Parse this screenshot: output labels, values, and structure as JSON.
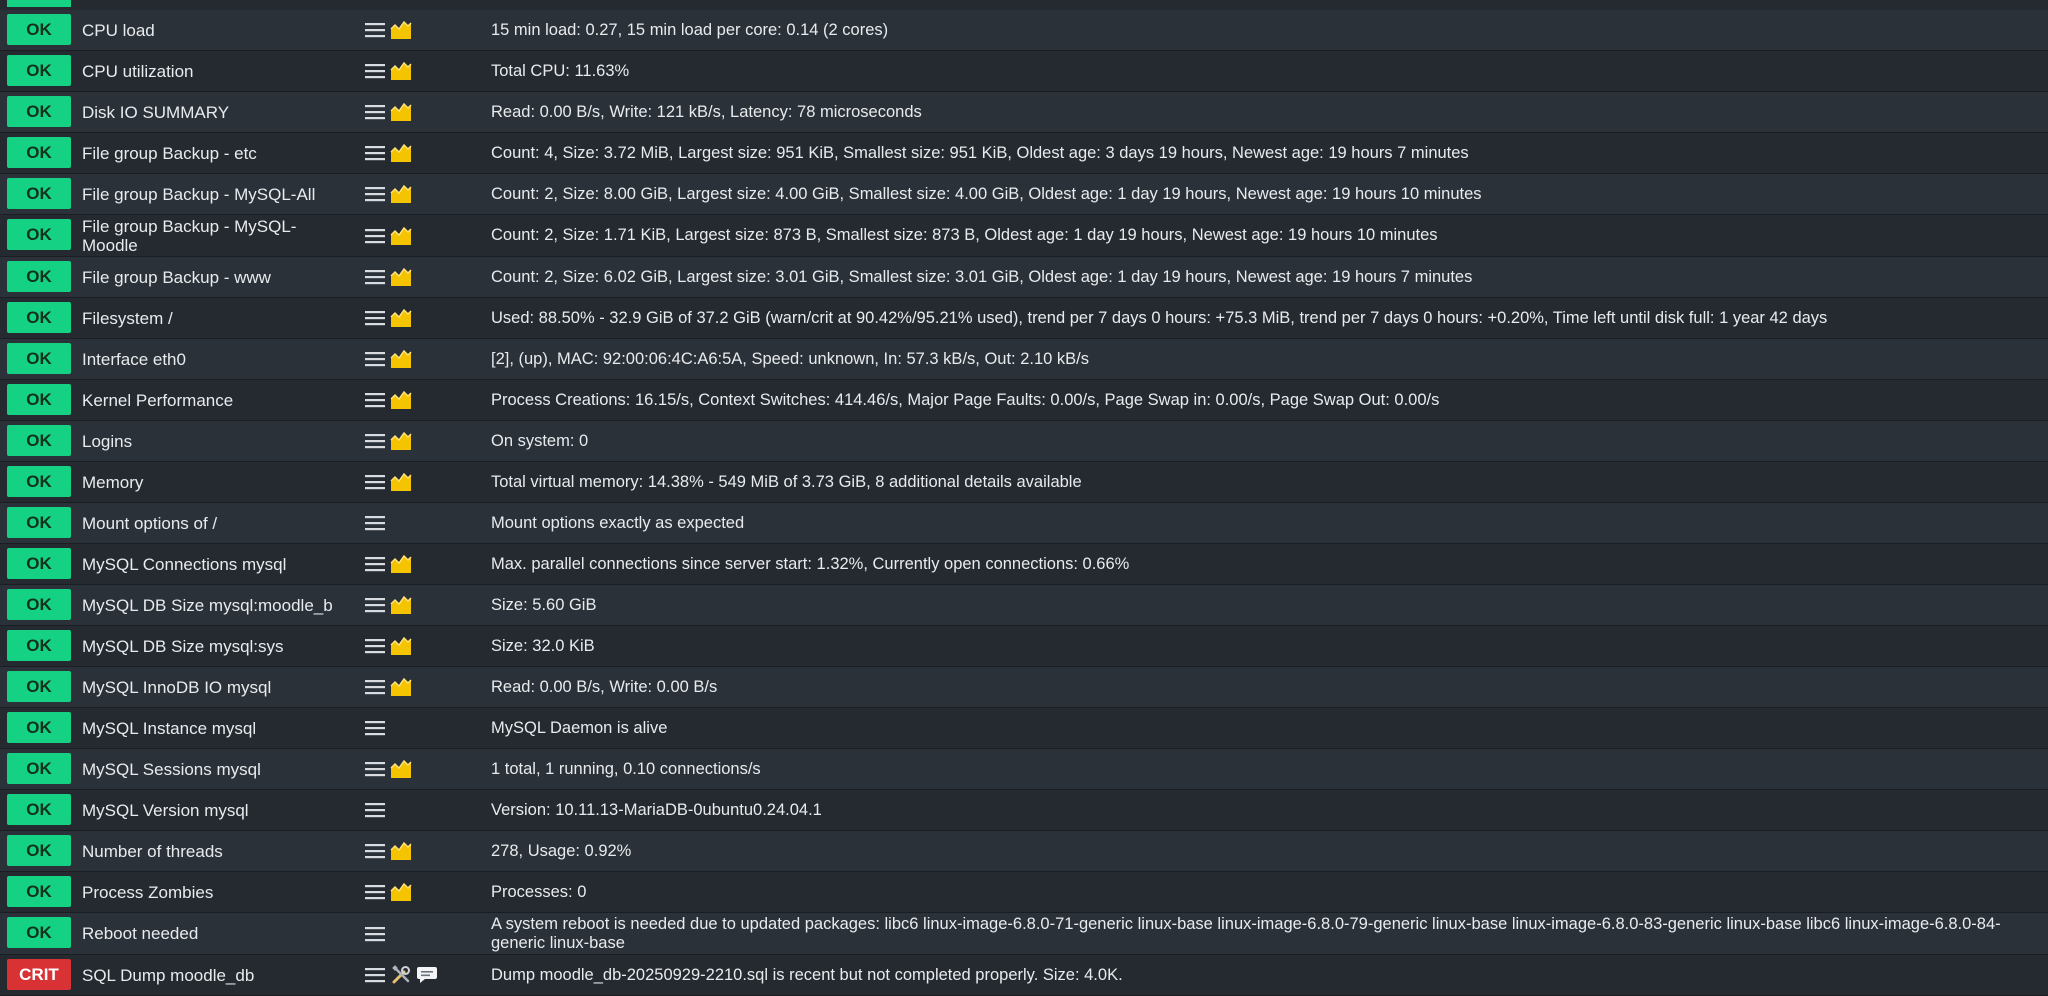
{
  "colors": {
    "ok": "#15d183",
    "crit": "#d93235",
    "row_dark": "#252a30",
    "row_light": "#2b3138",
    "graph_icon": "#f5c400"
  },
  "icons": {
    "menu": "hamburger-menu-icon",
    "graph": "perfometer-graph-icon",
    "tools": "wrench-screwdriver-icon",
    "comment": "comment-icon"
  },
  "services": [
    {
      "state": "OK",
      "name": "CPU load",
      "graph": true,
      "summary": "15 min load: 0.27, 15 min load per core: 0.14 (2 cores)"
    },
    {
      "state": "OK",
      "name": "CPU utilization",
      "graph": true,
      "summary": "Total CPU: 11.63%"
    },
    {
      "state": "OK",
      "name": "Disk IO SUMMARY",
      "graph": true,
      "summary": "Read: 0.00 B/s, Write: 121 kB/s, Latency: 78 microseconds"
    },
    {
      "state": "OK",
      "name": "File group Backup - etc",
      "graph": true,
      "summary": "Count: 4, Size: 3.72 MiB, Largest size: 951 KiB, Smallest size: 951 KiB, Oldest age: 3 days 19 hours, Newest age: 19 hours 7 minutes"
    },
    {
      "state": "OK",
      "name": "File group Backup - MySQL-All",
      "graph": true,
      "summary": "Count: 2, Size: 8.00 GiB, Largest size: 4.00 GiB, Smallest size: 4.00 GiB, Oldest age: 1 day 19 hours, Newest age: 19 hours 10 minutes"
    },
    {
      "state": "OK",
      "name": "File group Backup - MySQL-Moodle",
      "graph": true,
      "summary": "Count: 2, Size: 1.71 KiB, Largest size: 873 B, Smallest size: 873 B, Oldest age: 1 day 19 hours, Newest age: 19 hours 10 minutes"
    },
    {
      "state": "OK",
      "name": "File group Backup - www",
      "graph": true,
      "summary": "Count: 2, Size: 6.02 GiB, Largest size: 3.01 GiB, Smallest size: 3.01 GiB, Oldest age: 1 day 19 hours, Newest age: 19 hours 7 minutes"
    },
    {
      "state": "OK",
      "name": "Filesystem /",
      "graph": true,
      "summary": "Used: 88.50% - 32.9 GiB of 37.2 GiB (warn/crit at 90.42%/95.21% used), trend per 7 days 0 hours: +75.3 MiB, trend per 7 days 0 hours: +0.20%, Time left until disk full: 1 year 42 days"
    },
    {
      "state": "OK",
      "name": "Interface eth0",
      "graph": true,
      "summary": "[2], (up), MAC: 92:00:06:4C:A6:5A, Speed: unknown, In: 57.3 kB/s, Out: 2.10 kB/s"
    },
    {
      "state": "OK",
      "name": "Kernel Performance",
      "graph": true,
      "summary": "Process Creations: 16.15/s, Context Switches: 414.46/s, Major Page Faults: 0.00/s, Page Swap in: 0.00/s, Page Swap Out: 0.00/s"
    },
    {
      "state": "OK",
      "name": "Logins",
      "graph": true,
      "summary": "On system: 0"
    },
    {
      "state": "OK",
      "name": "Memory",
      "graph": true,
      "summary": "Total virtual memory: 14.38% - 549 MiB of 3.73 GiB, 8 additional details available"
    },
    {
      "state": "OK",
      "name": "Mount options of /",
      "graph": false,
      "summary": "Mount options exactly as expected"
    },
    {
      "state": "OK",
      "name": "MySQL Connections mysql",
      "graph": true,
      "summary": "Max. parallel connections since server start: 1.32%, Currently open connections: 0.66%"
    },
    {
      "state": "OK",
      "name": "MySQL DB Size mysql:moodle_b",
      "graph": true,
      "summary": "Size: 5.60 GiB"
    },
    {
      "state": "OK",
      "name": "MySQL DB Size mysql:sys",
      "graph": true,
      "summary": "Size: 32.0 KiB"
    },
    {
      "state": "OK",
      "name": "MySQL InnoDB IO mysql",
      "graph": true,
      "summary": "Read: 0.00 B/s, Write: 0.00 B/s"
    },
    {
      "state": "OK",
      "name": "MySQL Instance mysql",
      "graph": false,
      "summary": "MySQL Daemon is alive"
    },
    {
      "state": "OK",
      "name": "MySQL Sessions mysql",
      "graph": true,
      "summary": "1 total, 1 running, 0.10 connections/s"
    },
    {
      "state": "OK",
      "name": "MySQL Version mysql",
      "graph": false,
      "summary": "Version: 10.11.13-MariaDB-0ubuntu0.24.04.1"
    },
    {
      "state": "OK",
      "name": "Number of threads",
      "graph": true,
      "summary": "278, Usage: 0.92%"
    },
    {
      "state": "OK",
      "name": "Process Zombies",
      "graph": true,
      "summary": "Processes: 0"
    },
    {
      "state": "OK",
      "name": "Reboot needed",
      "graph": false,
      "summary": "A system reboot is needed due to updated packages: libc6 linux-image-6.8.0-71-generic linux-base linux-image-6.8.0-79-generic linux-base linux-image-6.8.0-83-generic linux-base libc6 linux-image-6.8.0-84-generic linux-base"
    },
    {
      "state": "CRIT",
      "name": "SQL Dump moodle_db",
      "graph": false,
      "tools": true,
      "comment": true,
      "summary": "Dump moodle_db-20250929-2210.sql is recent but not completed properly. Size: 4.0K."
    }
  ]
}
